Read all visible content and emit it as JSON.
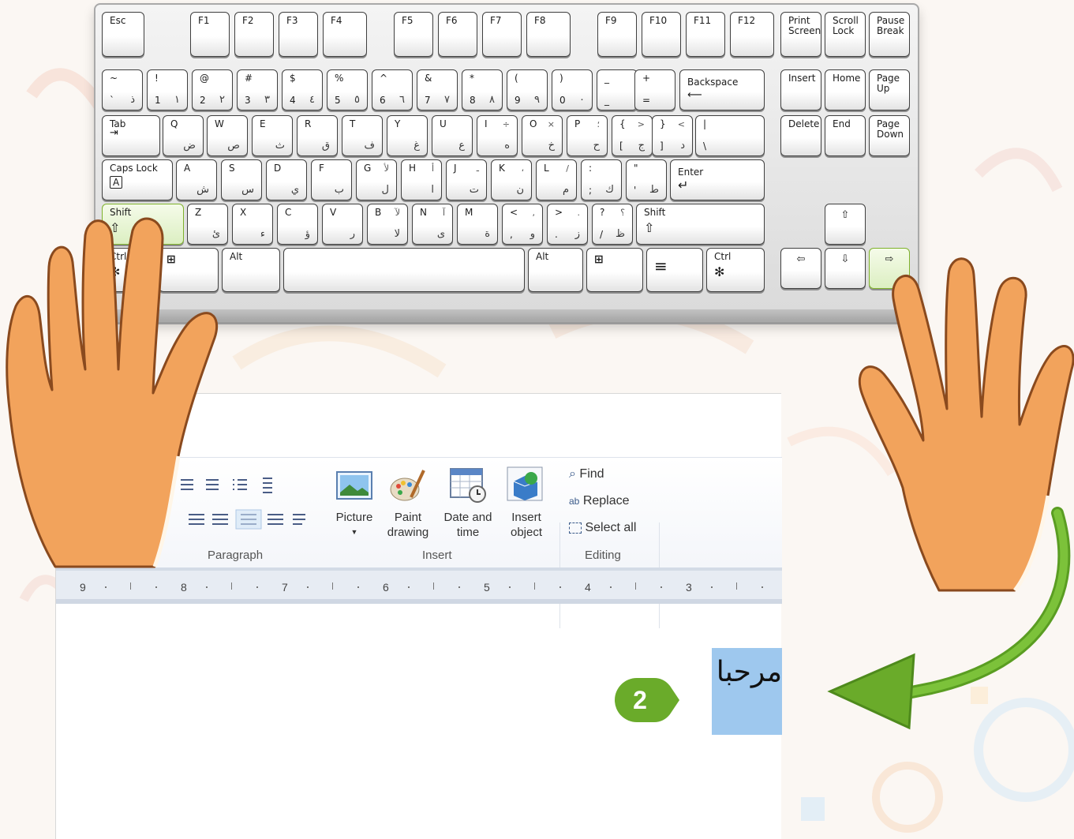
{
  "keyboard": {
    "function_row": [
      {
        "id": "esc",
        "label": "Esc"
      },
      {
        "id": "f1",
        "label": "F1"
      },
      {
        "id": "f2",
        "label": "F2"
      },
      {
        "id": "f3",
        "label": "F3"
      },
      {
        "id": "f4",
        "label": "F4"
      },
      {
        "id": "f5",
        "label": "F5"
      },
      {
        "id": "f6",
        "label": "F6"
      },
      {
        "id": "f7",
        "label": "F7"
      },
      {
        "id": "f8",
        "label": "F8"
      },
      {
        "id": "f9",
        "label": "F9"
      },
      {
        "id": "f10",
        "label": "F10"
      },
      {
        "id": "f11",
        "label": "F11"
      },
      {
        "id": "f12",
        "label": "F12"
      },
      {
        "id": "print-screen",
        "label": "Print\nScreen"
      },
      {
        "id": "scroll-lock",
        "label": "Scroll\nLock"
      },
      {
        "id": "pause-break",
        "label": "Pause\nBreak"
      }
    ],
    "number_row": [
      {
        "id": "tilde",
        "shift": "~",
        "base": "`",
        "arabic": "ذ"
      },
      {
        "id": "1",
        "shift": "!",
        "base": "1",
        "arabic": "١"
      },
      {
        "id": "2",
        "shift": "@",
        "base": "2",
        "arabic": "٢"
      },
      {
        "id": "3",
        "shift": "#",
        "base": "3",
        "arabic": "٣"
      },
      {
        "id": "4",
        "shift": "$",
        "base": "4",
        "arabic": "٤"
      },
      {
        "id": "5",
        "shift": "%",
        "base": "5",
        "arabic": "٥"
      },
      {
        "id": "6",
        "shift": "^",
        "base": "6",
        "arabic": "٦"
      },
      {
        "id": "7",
        "shift": "&",
        "base": "7",
        "arabic": "٧"
      },
      {
        "id": "8",
        "shift": "*",
        "base": "8",
        "arabic": "٨"
      },
      {
        "id": "9",
        "shift": "(",
        "base": "9",
        "arabic": "٩"
      },
      {
        "id": "0",
        "shift": ")",
        "base": "0",
        "arabic": "٠"
      },
      {
        "id": "minus",
        "shift": "_",
        "base": "_",
        "arabic": ""
      },
      {
        "id": "plus",
        "shift": "+",
        "base": "=",
        "arabic": ""
      },
      {
        "id": "backspace",
        "label": "Backspace"
      }
    ],
    "top_row": [
      {
        "id": "tab",
        "label": "Tab"
      },
      {
        "id": "q",
        "base": "Q",
        "arabic": "ض"
      },
      {
        "id": "w",
        "base": "W",
        "arabic": "ص"
      },
      {
        "id": "e",
        "base": "E",
        "arabic": "ث"
      },
      {
        "id": "r",
        "base": "R",
        "arabic": "ق"
      },
      {
        "id": "t",
        "base": "T",
        "arabic": "ف"
      },
      {
        "id": "y",
        "base": "Y",
        "arabic": "غ"
      },
      {
        "id": "u",
        "base": "U",
        "arabic": "ع"
      },
      {
        "id": "i",
        "base": "I",
        "arabic": "ه",
        "shift_ar": "÷"
      },
      {
        "id": "o",
        "base": "O",
        "arabic": "خ",
        "shift_ar": "×"
      },
      {
        "id": "p",
        "base": "P",
        "arabic": "ح",
        "shift_ar": "؛"
      },
      {
        "id": "bracket-open",
        "shift": "{",
        "base": "[",
        "arabic": "ج",
        "shift_ar": ">"
      },
      {
        "id": "bracket-close",
        "shift": "}",
        "base": "]",
        "arabic": "د",
        "shift_ar": "<"
      },
      {
        "id": "backslash",
        "shift": "|",
        "base": "\\"
      }
    ],
    "home_row": [
      {
        "id": "caps-lock",
        "label": "Caps Lock",
        "glyph": "A"
      },
      {
        "id": "a",
        "base": "A",
        "arabic": "ش"
      },
      {
        "id": "s",
        "base": "S",
        "arabic": "س"
      },
      {
        "id": "d",
        "base": "D",
        "arabic": "ي"
      },
      {
        "id": "f",
        "base": "F",
        "arabic": "ب"
      },
      {
        "id": "g",
        "base": "G",
        "arabic": "ل",
        "shift_ar": "لأ"
      },
      {
        "id": "h",
        "base": "H",
        "arabic": "ا",
        "shift_ar": "أ"
      },
      {
        "id": "j",
        "base": "J",
        "arabic": "ت",
        "shift_ar": "ـ"
      },
      {
        "id": "k",
        "base": "K",
        "arabic": "ن",
        "shift_ar": "،"
      },
      {
        "id": "l",
        "base": "L",
        "arabic": "م",
        "shift_ar": "/"
      },
      {
        "id": "semicolon",
        "shift": ":",
        "base": ";",
        "arabic": "ك"
      },
      {
        "id": "quote",
        "shift": "\"",
        "base": "'",
        "arabic": "ط"
      },
      {
        "id": "enter",
        "label": "Enter"
      }
    ],
    "shift_row": [
      {
        "id": "shift-left",
        "label": "Shift",
        "glyph": "⇧"
      },
      {
        "id": "z",
        "base": "Z",
        "arabic": "ئ"
      },
      {
        "id": "x",
        "base": "X",
        "arabic": "ء"
      },
      {
        "id": "c",
        "base": "C",
        "arabic": "ؤ"
      },
      {
        "id": "v",
        "base": "V",
        "arabic": "ر"
      },
      {
        "id": "b",
        "base": "B",
        "arabic": "لا",
        "shift_ar": "لآ"
      },
      {
        "id": "n",
        "base": "N",
        "arabic": "ى",
        "shift_ar": "آ"
      },
      {
        "id": "m",
        "base": "M",
        "arabic": "ة"
      },
      {
        "id": "comma",
        "shift": "<",
        "base": ",",
        "arabic": "و",
        "shift_ar": ","
      },
      {
        "id": "period",
        "shift": ">",
        "base": ".",
        "arabic": "ز",
        "shift_ar": "."
      },
      {
        "id": "slash",
        "shift": "?",
        "base": "/",
        "arabic": "ظ",
        "shift_ar": "؟"
      },
      {
        "id": "shift-right",
        "label": "Shift",
        "glyph": "⇧"
      }
    ],
    "bottom_row": [
      {
        "id": "ctrl-left",
        "label": "Ctrl",
        "glyph": "✻"
      },
      {
        "id": "win-left",
        "label": ""
      },
      {
        "id": "alt-left",
        "label": "Alt"
      },
      {
        "id": "space",
        "label": ""
      },
      {
        "id": "alt-right",
        "label": "Alt"
      },
      {
        "id": "win-right",
        "label": ""
      },
      {
        "id": "menu",
        "label": ""
      },
      {
        "id": "ctrl-right",
        "label": "Ctrl",
        "glyph": "✻"
      }
    ],
    "nav_cluster": [
      {
        "id": "insert",
        "label": "Insert"
      },
      {
        "id": "home",
        "label": "Home"
      },
      {
        "id": "page-up",
        "label": "Page\nUp"
      },
      {
        "id": "delete",
        "label": "Delete"
      },
      {
        "id": "end",
        "label": "End"
      },
      {
        "id": "page-down",
        "label": "Page\nDown"
      }
    ],
    "arrows": {
      "up": "⇧",
      "left": "⇦",
      "down": "⇩",
      "right": "⇨"
    }
  },
  "ribbon": {
    "insert": {
      "picture": "Picture",
      "paint_drawing": "Paint\ndrawing",
      "date_time": "Date and\ntime",
      "insert_object": "Insert\nobject",
      "group_label": "Insert"
    },
    "editing": {
      "find": "Find",
      "replace": "Replace",
      "select_all": "Select all",
      "group_label": "Editing"
    },
    "paragraph_group_label": "Paragraph"
  },
  "ruler": {
    "labels": [
      "9",
      "8",
      "7",
      "6",
      "5",
      "4",
      "3"
    ]
  },
  "document": {
    "selected_text": "مرحبا"
  },
  "step": {
    "number": "2"
  },
  "colors": {
    "highlight_green": "#7fb22c",
    "arrow_green": "#6aab2a",
    "selection_blue": "#9ec8ee",
    "hand_orange": "#f2a35c"
  }
}
